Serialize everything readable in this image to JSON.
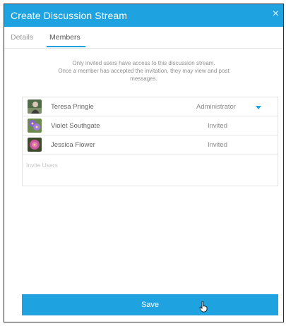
{
  "dialog": {
    "title": "Create Discussion Stream",
    "close_icon": "close-icon",
    "close_glyph": "×"
  },
  "tabs": [
    {
      "label": "Details",
      "active": false
    },
    {
      "label": "Members",
      "active": true
    }
  ],
  "info": {
    "line1": "Only invited users have access to this discussion stream.",
    "line2": "Once a member has accepted the invitation, they may view and post",
    "line3": "messages."
  },
  "members": [
    {
      "name": "Teresa Pringle",
      "role": "Administrator",
      "avatar_icon": "teresa-avatar",
      "has_dropdown": true
    },
    {
      "name": "Violet Southgate",
      "role": "Invited",
      "avatar_icon": "violet-flower-avatar",
      "has_dropdown": false
    },
    {
      "name": "Jessica Flower",
      "role": "Invited",
      "avatar_icon": "pink-flower-avatar",
      "has_dropdown": false
    }
  ],
  "invite": {
    "placeholder": "Invite Users",
    "value": ""
  },
  "save_button": {
    "label": "Save"
  },
  "colors": {
    "accent": "#1ea3e0",
    "text_muted": "#8f8f8f"
  }
}
